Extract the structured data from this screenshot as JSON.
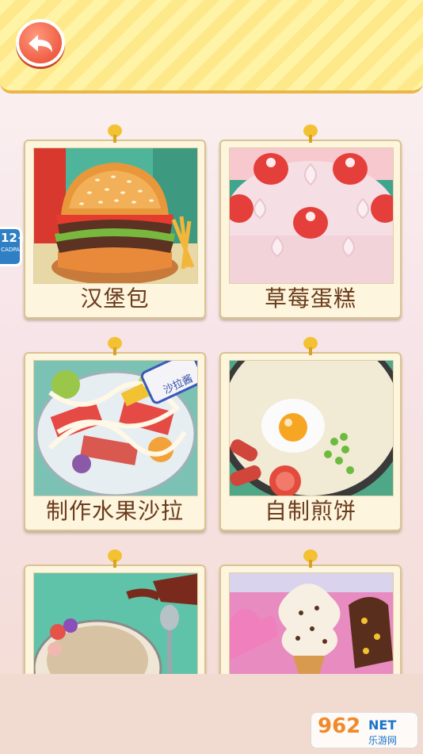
{
  "header": {
    "back_label": ""
  },
  "age_badge": {
    "age": "12+",
    "org": "CADPA"
  },
  "cards": [
    {
      "label": "汉堡包",
      "image": "burger-image"
    },
    {
      "label": "草莓蛋糕",
      "image": "strawberry-cake-image"
    },
    {
      "label": "制作水果沙拉",
      "image": "fruit-salad-image"
    },
    {
      "label": "自制煎饼",
      "image": "pancake-image"
    },
    {
      "label": "",
      "image": "ice-dessert-image"
    },
    {
      "label": "",
      "image": "ice-cream-image"
    }
  ],
  "salad_bottle_text": "沙拉酱",
  "watermark": {
    "number": "962",
    "net": "NET",
    "sub": "乐游网"
  },
  "colors": {
    "accent": "#ef5d44",
    "label_text": "#6b3b1d",
    "card_bg": "#fdf5dd"
  }
}
